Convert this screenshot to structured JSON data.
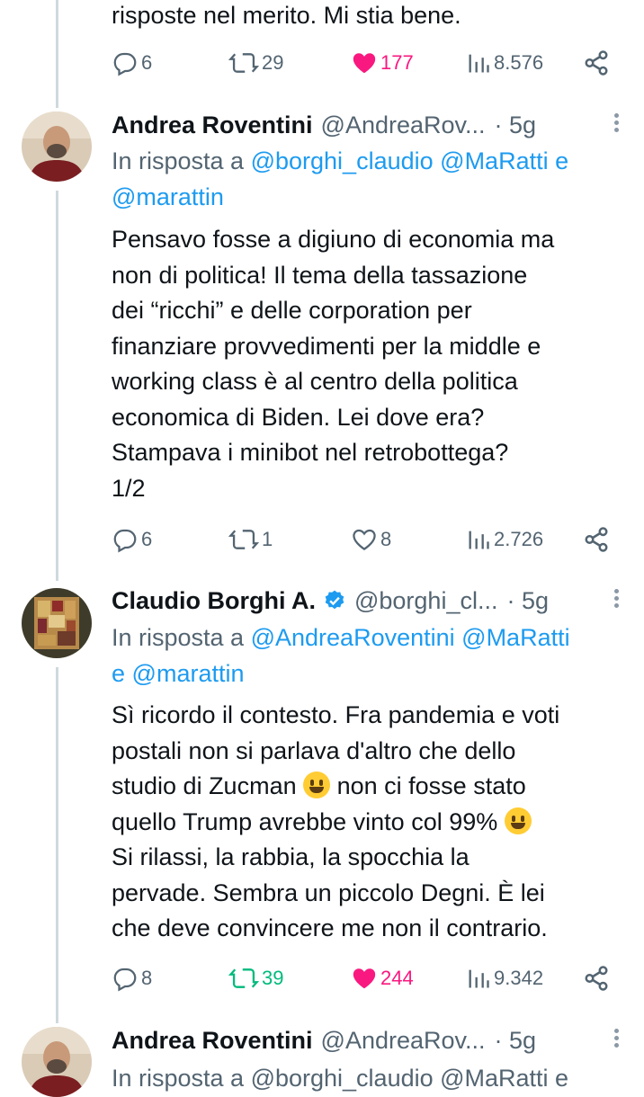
{
  "tweet0": {
    "text_tail": "risposte nel merito. Mi stia bene.",
    "replies": "6",
    "retweets": "29",
    "likes": "177",
    "views": "8.576"
  },
  "tweet1": {
    "name": "Andrea Roventini",
    "handle": "@AndreaRov...",
    "time": "· 5g",
    "reply_prefix": "In risposta a",
    "mention1": "@borghi_claudio",
    "mention2": "@MaRatti",
    "conj": "e",
    "mention3": "@marattin",
    "text": "Pensavo fosse a digiuno di economia ma\nnon di politica! Il tema della tassazione\ndei “ricchi” e delle corporation per\nfinanziare provvedimenti per la middle e\nworking class è al centro della politica\neconomica di Biden. Lei dove era?\nStampava i minibot nel retrobottega?\n1/2",
    "replies": "6",
    "retweets": "1",
    "likes": "8",
    "views": "2.726"
  },
  "tweet2": {
    "name": "Claudio Borghi A.",
    "handle": "@borghi_cl...",
    "time": "· 5g",
    "reply_prefix": "In risposta a",
    "mention1": "@AndreaRoventini",
    "mention2": "@MaRatti",
    "conj": "e",
    "mention3": "@marattin",
    "text_l1": "Sì ricordo il contesto. Fra pandemia e voti",
    "text_l2": "postali non si parlava d'altro che dello",
    "text_l3a": "studio di Zucman ",
    "text_l3b": " non ci fosse stato",
    "text_l4a": "quello Trump avrebbe vinto col 99% ",
    "text_rest": "Si rilassi, la rabbia, la spocchia la\npervade. Sembra un piccolo Degni. È lei\nche deve convincere me non il contrario.",
    "replies": "8",
    "retweets": "39",
    "likes": "244",
    "views": "9.342"
  },
  "tweet3": {
    "name": "Andrea Roventini",
    "handle": "@AndreaRov...",
    "time": "· 5g",
    "reply_partial": "In risposta a @borghi_claudio @MaRatti e"
  },
  "colors": {
    "link": "#1d9bf0",
    "like": "#f91880",
    "retweet": "#00ba7c",
    "muted": "#536471",
    "verified": "#1d9bf0"
  }
}
